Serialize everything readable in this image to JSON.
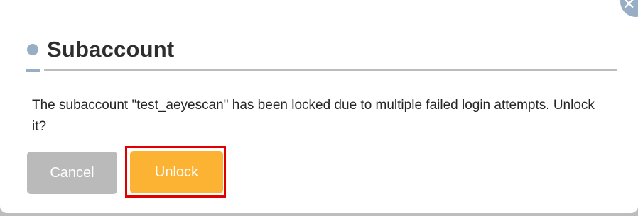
{
  "dialog": {
    "title": "Subaccount",
    "message": "The subaccount \"test_aeyescan\" has been locked due to multiple failed login attempts. Unlock it?",
    "close_icon": "close-icon",
    "buttons": {
      "cancel_label": "Cancel",
      "unlock_label": "Unlock"
    }
  },
  "colors": {
    "accent": "#98aec4",
    "primary_button": "#fcb232",
    "secondary_button": "#bababa",
    "highlight_outline": "#e00000"
  }
}
